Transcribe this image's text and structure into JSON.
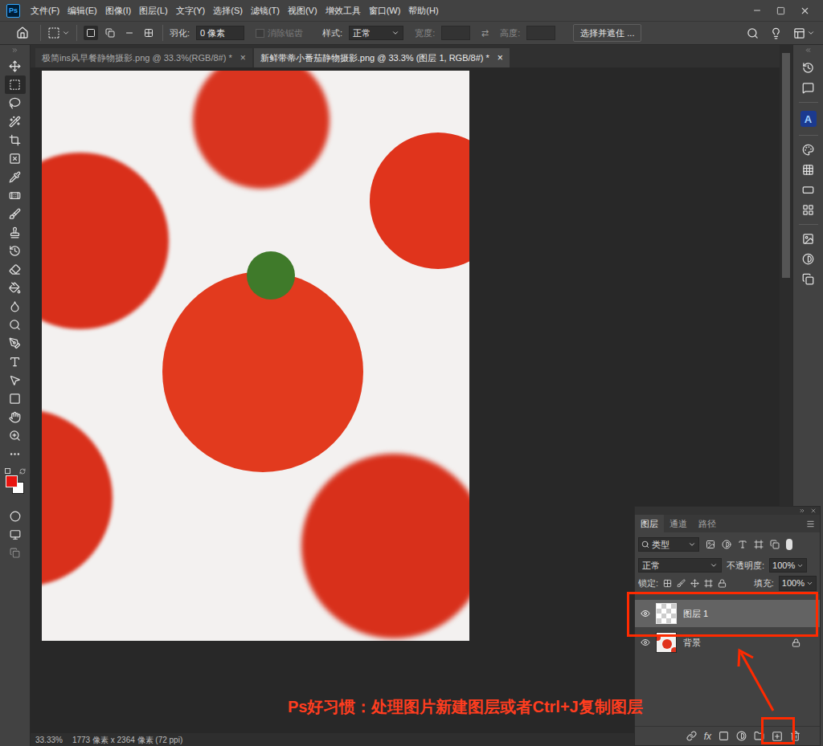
{
  "app": {
    "logo": "Ps"
  },
  "menu": [
    "文件(F)",
    "编辑(E)",
    "图像(I)",
    "图层(L)",
    "文字(Y)",
    "选择(S)",
    "滤镜(T)",
    "视图(V)",
    "增效工具",
    "窗口(W)",
    "帮助(H)"
  ],
  "options": {
    "selection_mode": 0,
    "feather_label": "羽化:",
    "feather_value": "0 像素",
    "antialias": {
      "label": "消除锯齿",
      "checked": false,
      "disabled": true
    },
    "style_label": "样式:",
    "style_value": "正常",
    "width_label": "宽度:",
    "swap": "⇄",
    "height_label": "高度:",
    "select_mask": "选择并遮住 ..."
  },
  "doc_tabs": [
    {
      "label": "极简ins风早餐静物摄影.png @ 33.3%(RGB/8#) *",
      "selected": false,
      "close": "×"
    },
    {
      "label": "新鲜带蒂小番茄静物摄影.png @ 33.3% (图层 1, RGB/8#) *",
      "selected": true,
      "close": "×"
    }
  ],
  "toolbar": {
    "active_tool": 1
  },
  "swatches": [
    {
      "role": "foreground",
      "color": "#e8140f"
    },
    {
      "role": "background",
      "color": "#ffffff"
    }
  ],
  "right_panel": {
    "plugin_logo": "A"
  },
  "layers_panel": {
    "tabs": [
      {
        "label": "图层",
        "selected": true
      },
      {
        "label": "通道",
        "selected": false
      },
      {
        "label": "路径",
        "selected": false
      }
    ],
    "filter": "类型",
    "blend_mode": "正常",
    "opacity_label": "不透明度:",
    "opacity": "100%",
    "lock_label": "锁定:",
    "fill_label": "填充:",
    "fill": "100%",
    "layers": [
      {
        "name": "图层 1",
        "selected": true,
        "visible": true,
        "locked": false,
        "kind": "transparent"
      },
      {
        "name": "背景",
        "selected": false,
        "visible": true,
        "locked": true,
        "kind": "image"
      }
    ],
    "fx": "fx"
  },
  "annotation": {
    "text": "Ps好习惯：处理图片新建图层或者Ctrl+J复制图层"
  },
  "status_bar": {
    "zoom": "33.33%",
    "info": "1773 像素 x 2364 像素 (72 ppi)"
  }
}
